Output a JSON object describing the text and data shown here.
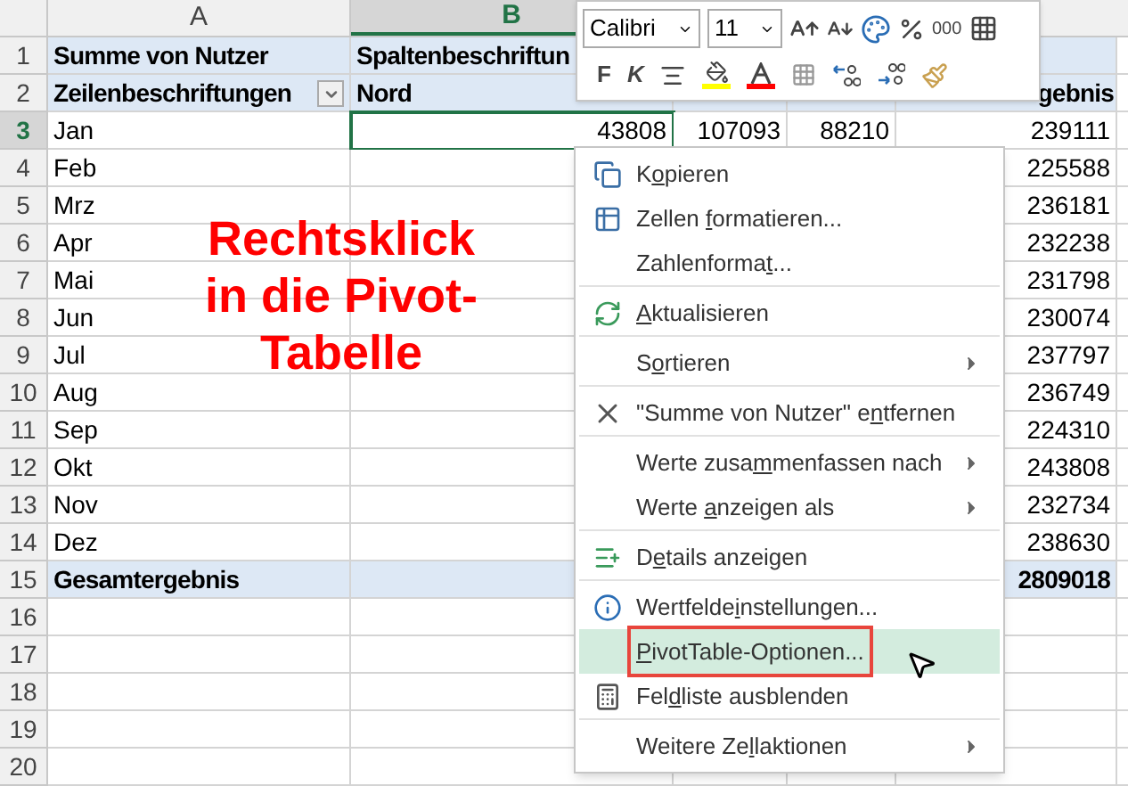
{
  "column_headers": [
    {
      "label": "A",
      "selected": false
    },
    {
      "label": "B",
      "selected": true
    }
  ],
  "rows": [
    {
      "number": "1",
      "selected": false,
      "kind": "pivot_header",
      "cells": {
        "a": "Summe von Nutzer",
        "b": "Spaltenbeschriftun"
      }
    },
    {
      "number": "2",
      "selected": false,
      "kind": "pivot_header",
      "filter": true,
      "cells": {
        "a": "Zeilenbeschriftungen",
        "b": "Nord",
        "e": "gebnis"
      }
    },
    {
      "number": "3",
      "selected": true,
      "kind": "data",
      "cells": {
        "a": "Jan",
        "b": "43808",
        "c": "107093",
        "d": "88210",
        "e": "239111"
      }
    },
    {
      "number": "4",
      "selected": false,
      "kind": "data",
      "cells": {
        "a": "Feb",
        "e": "225588"
      }
    },
    {
      "number": "5",
      "selected": false,
      "kind": "data",
      "cells": {
        "a": "Mrz",
        "e": "236181"
      }
    },
    {
      "number": "6",
      "selected": false,
      "kind": "data",
      "cells": {
        "a": "Apr",
        "e": "232238"
      }
    },
    {
      "number": "7",
      "selected": false,
      "kind": "data",
      "cells": {
        "a": "Mai",
        "e": "231798"
      }
    },
    {
      "number": "8",
      "selected": false,
      "kind": "data",
      "cells": {
        "a": "Jun",
        "e": "230074"
      }
    },
    {
      "number": "9",
      "selected": false,
      "kind": "data",
      "cells": {
        "a": "Jul",
        "e": "237797"
      }
    },
    {
      "number": "10",
      "selected": false,
      "kind": "data",
      "cells": {
        "a": "Aug",
        "e": "236749"
      }
    },
    {
      "number": "11",
      "selected": false,
      "kind": "data",
      "cells": {
        "a": "Sep",
        "e": "224310"
      }
    },
    {
      "number": "12",
      "selected": false,
      "kind": "data",
      "cells": {
        "a": "Okt",
        "e": "243808"
      }
    },
    {
      "number": "13",
      "selected": false,
      "kind": "data",
      "cells": {
        "a": "Nov",
        "e": "232734"
      }
    },
    {
      "number": "14",
      "selected": false,
      "kind": "data",
      "cells": {
        "a": "Dez",
        "e": "238630"
      }
    },
    {
      "number": "15",
      "selected": false,
      "kind": "total",
      "cells": {
        "a": "Gesamtergebnis",
        "e": "2809018"
      }
    },
    {
      "number": "16",
      "selected": false,
      "kind": "empty",
      "cells": {}
    },
    {
      "number": "17",
      "selected": false,
      "kind": "empty",
      "cells": {}
    },
    {
      "number": "18",
      "selected": false,
      "kind": "empty",
      "cells": {}
    },
    {
      "number": "19",
      "selected": false,
      "kind": "empty",
      "cells": {}
    },
    {
      "number": "20",
      "selected": false,
      "kind": "empty",
      "cells": {}
    }
  ],
  "annotation": {
    "lines": [
      "Rechtsklick",
      "in die Pivot-",
      "Tabelle"
    ]
  },
  "mini_toolbar": {
    "font": "Calibri",
    "size": "11",
    "bold": "F",
    "italic": "K",
    "thousands": "000"
  },
  "context_menu": [
    {
      "kind": "copy",
      "before": "K",
      "key": "o",
      "after": "pieren",
      "submenu": false,
      "separator_before": false,
      "selected": false
    },
    {
      "kind": "format",
      "before": "Zellen ",
      "key": "f",
      "after": "ormatieren...",
      "submenu": false,
      "separator_before": false,
      "selected": false
    },
    {
      "before": "Zahlenforma",
      "key": "t",
      "after": "...",
      "submenu": false,
      "separator_before": false,
      "selected": false
    },
    {
      "kind": "refresh",
      "key": "A",
      "after": "ktualisieren",
      "submenu": false,
      "separator_before": true,
      "selected": false
    },
    {
      "before": "S",
      "key": "o",
      "after": "rtieren",
      "submenu": true,
      "separator_before": true,
      "selected": false
    },
    {
      "kind": "remove",
      "before": "\"Summe von Nutzer\" e",
      "key": "n",
      "after": "tfernen",
      "submenu": false,
      "separator_before": true,
      "selected": false
    },
    {
      "before": "Werte zusa",
      "key": "m",
      "after": "menfassen nach",
      "submenu": true,
      "separator_before": true,
      "selected": false
    },
    {
      "before": "Werte ",
      "key": "a",
      "after": "nzeigen als",
      "submenu": true,
      "separator_before": false,
      "selected": false
    },
    {
      "kind": "details",
      "before": "D",
      "key": "e",
      "after": "tails anzeigen",
      "submenu": false,
      "separator_before": true,
      "selected": false
    },
    {
      "kind": "settings",
      "before": "Wertfelde",
      "key": "i",
      "after": "nstellungen...",
      "submenu": false,
      "separator_before": true,
      "selected": false
    },
    {
      "key": "P",
      "after": "ivotTable-Optionen...",
      "submenu": false,
      "separator_before": false,
      "selected": true,
      "highlighted_box": true
    },
    {
      "kind": "fieldlist",
      "before": "Fel",
      "key": "d",
      "after": "liste ausblenden",
      "submenu": false,
      "separator_before": false,
      "selected": false
    },
    {
      "before": "Weitere Ze",
      "key": "l",
      "after": "laktionen",
      "submenu": true,
      "separator_before": true,
      "selected": false
    }
  ]
}
